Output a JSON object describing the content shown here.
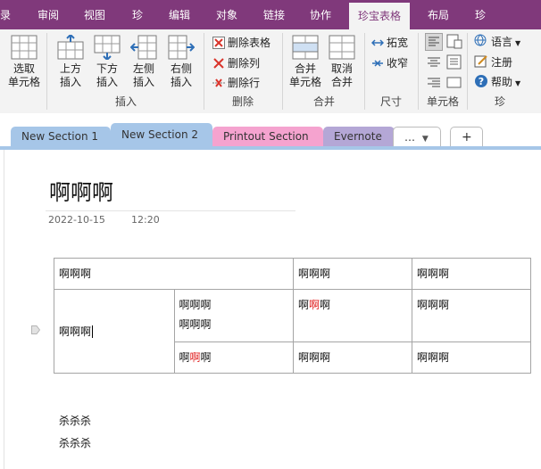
{
  "menu": {
    "tabs": [
      {
        "label": "录"
      },
      {
        "label": "审阅"
      },
      {
        "label": "视图"
      },
      {
        "label": "珍"
      },
      {
        "label": "编辑"
      },
      {
        "label": "对象"
      },
      {
        "label": "链接"
      },
      {
        "label": "协作"
      },
      {
        "label": "珍宝表格"
      },
      {
        "label": "布局"
      },
      {
        "label": "珍"
      }
    ]
  },
  "ribbon": {
    "select_cell_1": "选取",
    "select_cell_2": "单元格",
    "insert_above_1": "上方",
    "insert_above_2": "插入",
    "insert_below_1": "下方",
    "insert_below_2": "插入",
    "insert_left_1": "左侧",
    "insert_left_2": "插入",
    "insert_right_1": "右侧",
    "insert_right_2": "插入",
    "group_insert": "插入",
    "delete_table": "删除表格",
    "delete_column": "删除列",
    "delete_row": "删除行",
    "group_delete": "删除",
    "merge_1": "合并",
    "merge_2": "单元格",
    "unmerge_1": "取消",
    "unmerge_2": "合并",
    "group_merge": "合并",
    "widen": "拓宽",
    "narrow": "收窄",
    "group_size": "尺寸",
    "group_cell": "单元格",
    "language": "语言",
    "register": "注册",
    "help": "帮助",
    "group_jewel": "珍"
  },
  "sections": {
    "tabs": [
      {
        "label": "New Section 1",
        "color": "#a6c6e8"
      },
      {
        "label": "New Section 2",
        "color": "#a6c6e8"
      },
      {
        "label": "Printout Section",
        "color": "#f5a3cf"
      },
      {
        "label": "Evernote",
        "color": "#b4a7d6"
      }
    ],
    "more": "…",
    "add": "+"
  },
  "page": {
    "title": "啊啊啊",
    "date": "2022-10-15",
    "time": "12:20"
  },
  "table": {
    "r1c1": "啊啊啊",
    "r1c3": "啊啊啊",
    "r1c4": "啊啊啊",
    "r2c1": "啊啊啊",
    "r2c2_line1": "啊啊啊",
    "r2c2_line2": "啊啊啊",
    "r2c3_a": "啊",
    "r2c3_b": "啊",
    "r2c3_c": "啊",
    "r2c4": "啊啊啊",
    "r3c2_a": "啊",
    "r3c2_b": "啊",
    "r3c2_c": "啊",
    "r3c3": "啊啊啊",
    "r3c4": "啊啊啊"
  },
  "notes": [
    "杀杀杀",
    "杀杀杀"
  ]
}
